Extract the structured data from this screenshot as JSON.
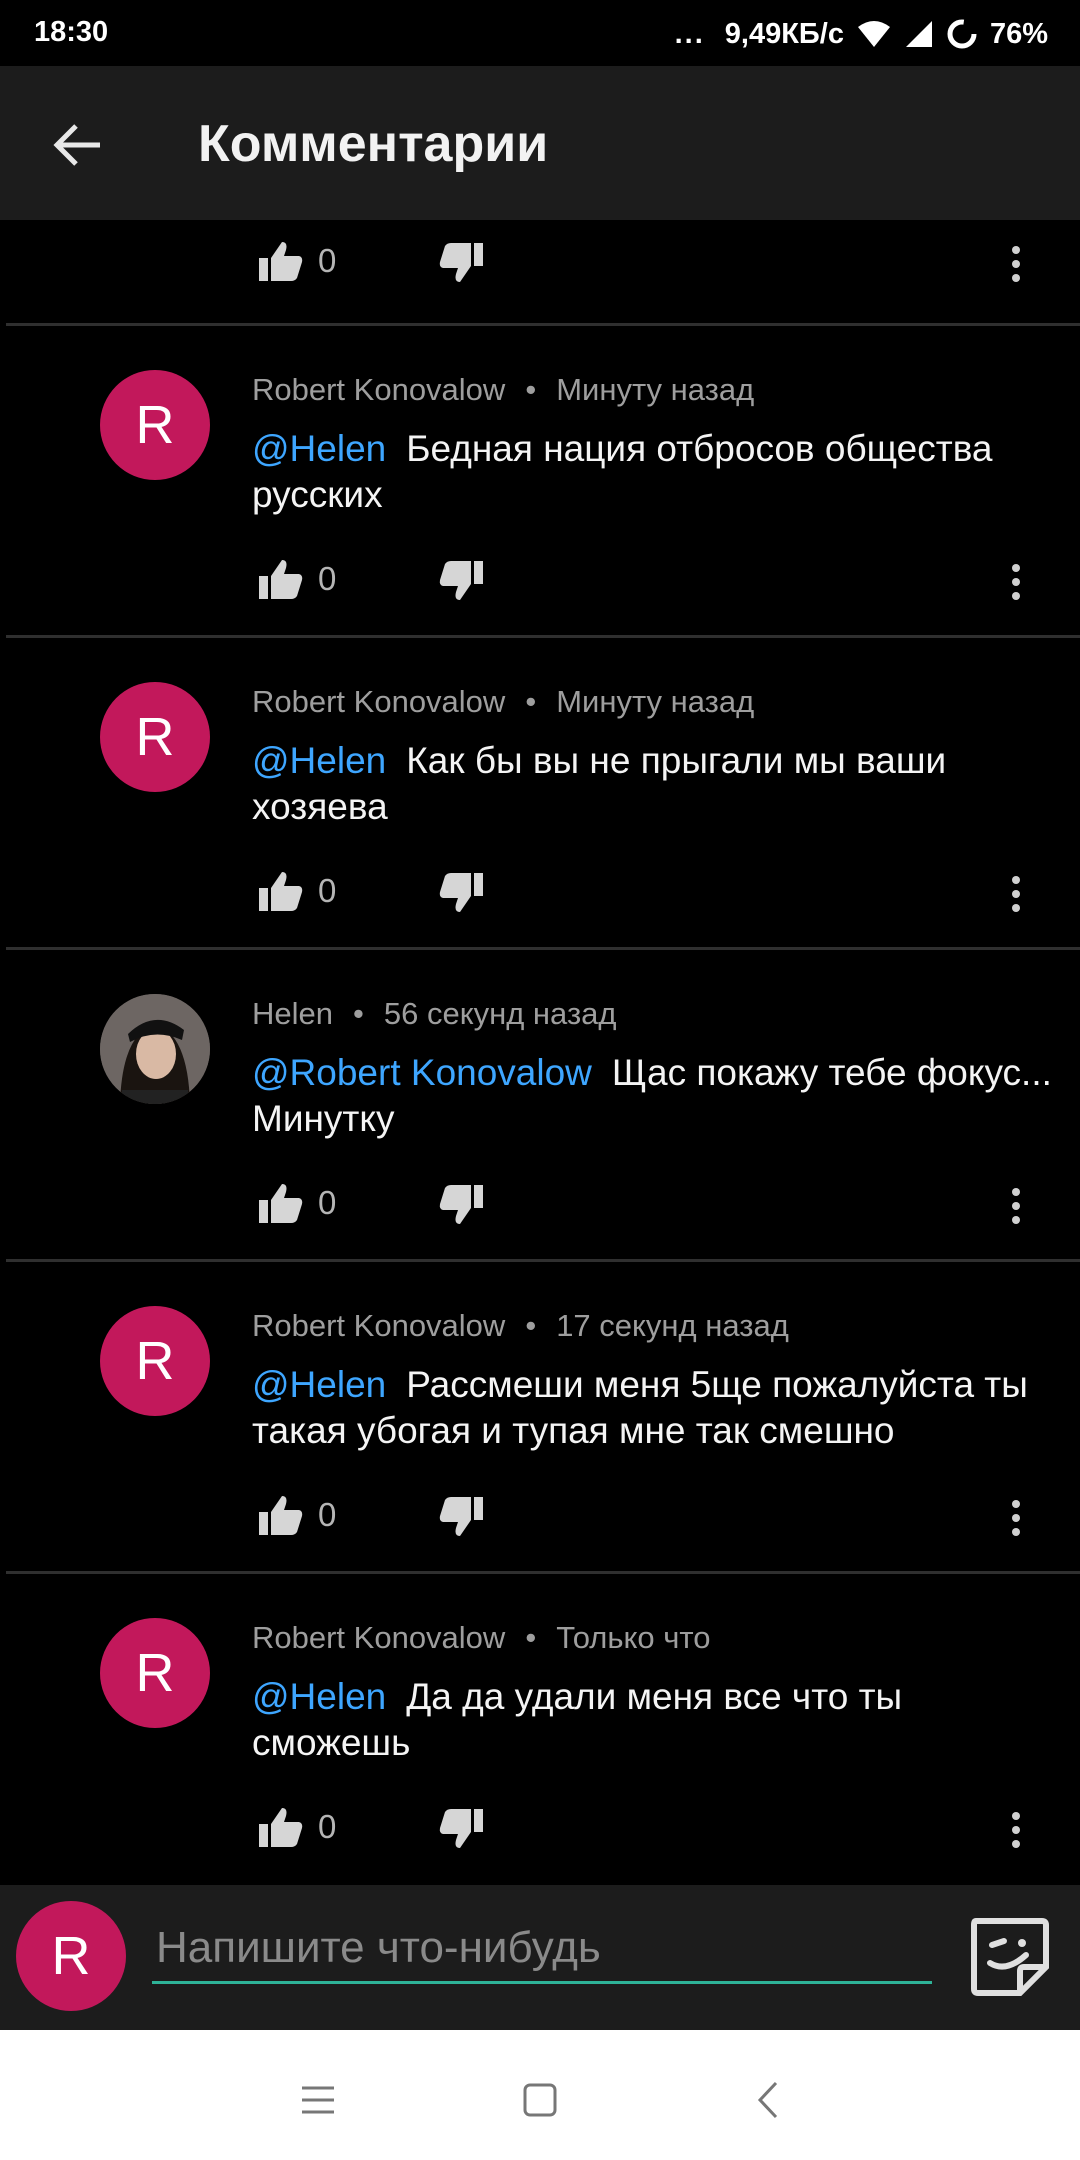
{
  "status_bar": {
    "time": "18:30",
    "dots": "...",
    "speed": "9,49КБ/с",
    "battery": "76%"
  },
  "header": {
    "title": "Комментарии"
  },
  "top_actions": {
    "likes": "0"
  },
  "comments": [
    {
      "author": "Robert Konovalow",
      "time": "Минуту назад",
      "mention": "@Helen",
      "text": "Бедная нация отбросов общества русских",
      "likes": "0",
      "avatar": "R"
    },
    {
      "author": "Robert Konovalow",
      "time": "Минуту назад",
      "mention": "@Helen",
      "text": "Как бы вы не прыгали мы ваши хозяева",
      "likes": "0",
      "avatar": "R"
    },
    {
      "author": "Helen",
      "time": "56 секунд назад",
      "mention": "@Robert Konovalow",
      "text": "Щас покажу тебе фокус... Минутку",
      "likes": "0",
      "avatar": ""
    },
    {
      "author": "Robert Konovalow",
      "time": "17 секунд назад",
      "mention": "@Helen",
      "text": "Рассмеши меня 5ще пожалуйста ты такая убогая и тупая мне так смешно",
      "likes": "0",
      "avatar": "R"
    },
    {
      "author": "Robert Konovalow",
      "time": "Только что",
      "mention": "@Helen",
      "text": "Да да удали меня все что ты сможешь",
      "likes": "0",
      "avatar": "R"
    }
  ],
  "compose": {
    "avatar": "R",
    "placeholder": "Напишите что-нибудь"
  },
  "colors": {
    "avatar": "#c2185b",
    "mention": "#3ea6ff",
    "accent": "#2eb398"
  }
}
